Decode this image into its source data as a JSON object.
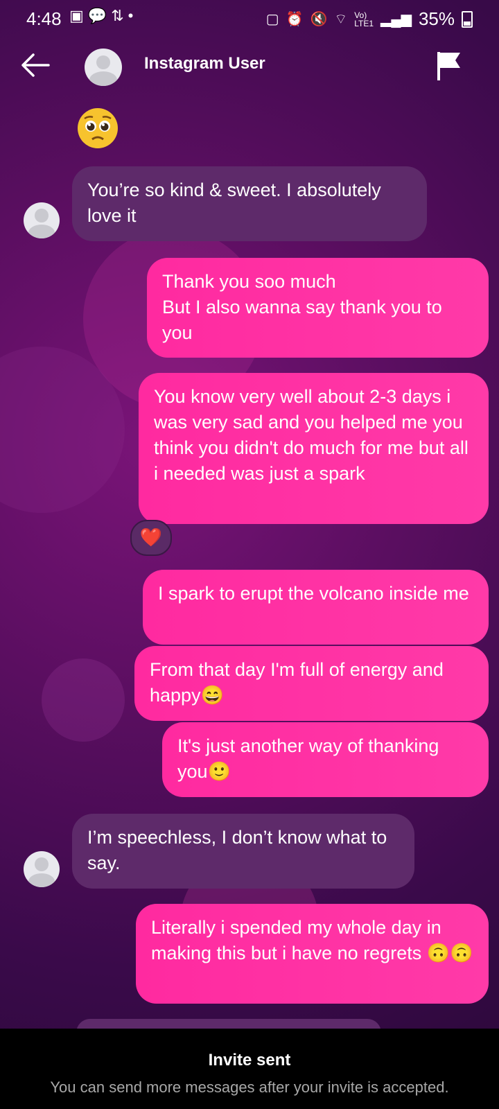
{
  "status_bar": {
    "time": "4:48",
    "battery": "35%",
    "left_icons": [
      "image-icon",
      "chat-icon",
      "data-arrows-icon",
      "dot-icon"
    ],
    "right_icons": [
      "battery-saver-icon",
      "alarm-icon",
      "mute-icon",
      "wifi-icon",
      "volte-icon",
      "signal-icon"
    ]
  },
  "header": {
    "username": "Instagram User",
    "back_icon": "arrow-left-icon",
    "report_icon": "flag-icon"
  },
  "messages": [
    {
      "direction": "incoming",
      "type": "emoji",
      "text": "🥺"
    },
    {
      "direction": "incoming",
      "text": "You’re so kind & sweet. I absolutely love it"
    },
    {
      "direction": "outgoing",
      "text": "Thank you soo much\nBut I also wanna say thank you to you"
    },
    {
      "direction": "outgoing",
      "text": "You know very well about 2-3 days i was very sad and you helped me you think you didn't do much for me but all i needed was just a spark",
      "reaction": "❤️"
    },
    {
      "direction": "outgoing",
      "text": "I spark to erupt the volcano inside me"
    },
    {
      "direction": "outgoing",
      "text": "From that day I'm full of energy and happy😄"
    },
    {
      "direction": "outgoing",
      "text": "It's just another way of thanking you🙂"
    },
    {
      "direction": "incoming",
      "text": "I’m speechless, I don’t know what to say."
    },
    {
      "direction": "outgoing",
      "text": "Literally i spended my whole day in making this but i have no regrets 🙃🙃"
    }
  ],
  "footer": {
    "title": "Invite sent",
    "subtitle": "You can send more messages after your invite is accepted."
  },
  "colors": {
    "outgoing_bubble": "#ff2aa0",
    "incoming_bubble": "#5e2a6a",
    "footer_bg": "#000000"
  }
}
